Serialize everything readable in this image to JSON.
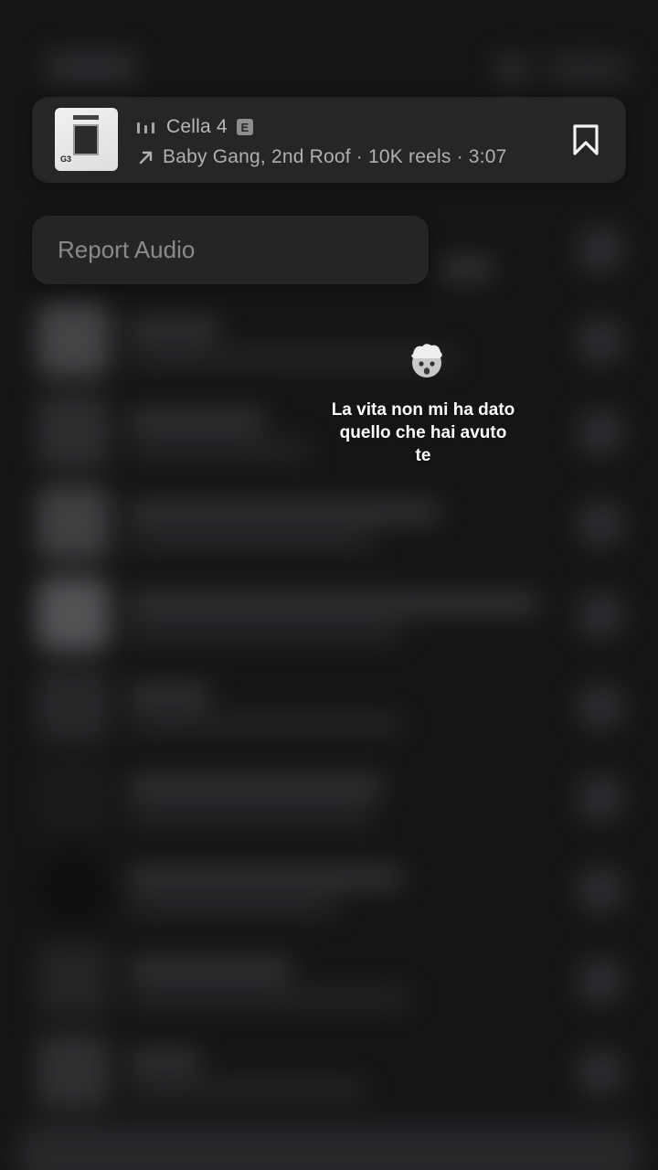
{
  "track_card": {
    "title": "Cella 4",
    "explicit_label": "E",
    "subtitle": "Baby Gang, 2nd Roof · 10K reels · 3:07",
    "album_tag": "G3",
    "icons": {
      "playing": "equalizer-bars-icon",
      "artist": "arrow-up-right-icon",
      "save": "bookmark-icon"
    }
  },
  "report_menu": {
    "item_label": "Report Audio"
  },
  "story": {
    "emoji": "exploding-head-emoji",
    "caption": "La vita non mi ha dato\nquello che hai avuto\nte"
  },
  "colors": {
    "background": "#151517",
    "card": "#262628",
    "text_secondary": "#b0b0b3",
    "caption": "#ffffff"
  }
}
